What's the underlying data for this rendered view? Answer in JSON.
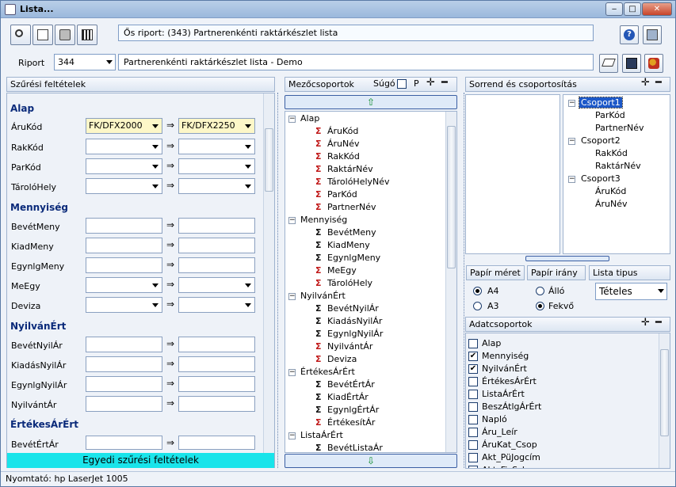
{
  "window": {
    "title": "Lista..."
  },
  "toolbar": {
    "report_header": "Ős riport: (343)  Partnerenkénti raktárkészlet lista"
  },
  "riport": {
    "label": "Riport",
    "code": "344",
    "name": "Partnerenkénti raktárkészlet lista - Demo"
  },
  "filters": {
    "title": "Szűrési feltételek",
    "arrow": "⇒",
    "sections": {
      "alap": "Alap",
      "mennyiseg": "Mennyiség",
      "nyilvanert": "NyilvánÉrt",
      "ertekesarert": "ÉrtékesÁrÉrt"
    },
    "rows": {
      "arukod": {
        "label": "ÁruKód",
        "from": "FK/DFX2000",
        "to": "FK/DFX2250"
      },
      "rakkod": {
        "label": "RakKód"
      },
      "parkod": {
        "label": "ParKód"
      },
      "tarolohely": {
        "label": "TárolóHely"
      },
      "betetmeny": {
        "label": "BevétMeny"
      },
      "kiadmeny": {
        "label": "KiadMeny"
      },
      "egynlgmeny": {
        "label": "EgynlgMeny"
      },
      "meegy": {
        "label": "MeEgy"
      },
      "deviza": {
        "label": "Deviza"
      },
      "betetnyilar": {
        "label": "BevétNyilÁr"
      },
      "kiadasnyilar": {
        "label": "KiadásNyilÁr"
      },
      "egynlgnyilar": {
        "label": "EgynlgNyilÁr"
      },
      "nyilvantar": {
        "label": "NyilvántÁr"
      },
      "betetertar": {
        "label": "BevétÉrtÁr"
      }
    },
    "custom_button": "Egyedi szűrési feltételek"
  },
  "fields": {
    "title": "Mezőcsoportok",
    "help": "Súgó",
    "p_label": "P",
    "tree": [
      {
        "type": "group",
        "label": "Alap"
      },
      {
        "type": "leaf",
        "sig": "red",
        "label": "ÁruKód"
      },
      {
        "type": "leaf",
        "sig": "red",
        "label": "ÁruNév"
      },
      {
        "type": "leaf",
        "sig": "red",
        "label": "RakKód"
      },
      {
        "type": "leaf",
        "sig": "red",
        "label": "RaktárNév"
      },
      {
        "type": "leaf",
        "sig": "red",
        "label": "TárolóHelyNév"
      },
      {
        "type": "leaf",
        "sig": "red",
        "label": "ParKód"
      },
      {
        "type": "leaf",
        "sig": "red",
        "label": "PartnerNév"
      },
      {
        "type": "group",
        "label": "Mennyiség"
      },
      {
        "type": "leaf",
        "sig": "blk",
        "label": "BevétMeny"
      },
      {
        "type": "leaf",
        "sig": "blk",
        "label": "KiadMeny"
      },
      {
        "type": "leaf",
        "sig": "blk",
        "label": "EgynlgMeny"
      },
      {
        "type": "leaf",
        "sig": "red",
        "label": "MeEgy"
      },
      {
        "type": "leaf",
        "sig": "red",
        "label": "TárolóHely"
      },
      {
        "type": "group",
        "label": "NyilvánÉrt"
      },
      {
        "type": "leaf",
        "sig": "blk",
        "label": "BevétNyilÁr"
      },
      {
        "type": "leaf",
        "sig": "blk",
        "label": "KiadásNyilÁr"
      },
      {
        "type": "leaf",
        "sig": "blk",
        "label": "EgynlgNyilÁr"
      },
      {
        "type": "leaf",
        "sig": "red",
        "label": "NyilvántÁr"
      },
      {
        "type": "leaf",
        "sig": "red",
        "label": "Deviza"
      },
      {
        "type": "group",
        "label": "ÉrtékesÁrÉrt"
      },
      {
        "type": "leaf",
        "sig": "blk",
        "label": "BevétÉrtÁr"
      },
      {
        "type": "leaf",
        "sig": "blk",
        "label": "KiadÉrtÁr"
      },
      {
        "type": "leaf",
        "sig": "blk",
        "label": "EgynlgÉrtÁr"
      },
      {
        "type": "leaf",
        "sig": "red",
        "label": "ÉrtékesítÁr"
      },
      {
        "type": "group",
        "label": "ListaÁrÉrt"
      },
      {
        "type": "leaf",
        "sig": "blk",
        "label": "BevétListaÁr"
      }
    ]
  },
  "sorting": {
    "title": "Sorrend és csoportosítás",
    "groups": [
      {
        "label": "Csoport1",
        "selected": true,
        "items": [
          "ParKód",
          "PartnerNév"
        ]
      },
      {
        "label": "Csoport2",
        "selected": false,
        "items": [
          "RakKód",
          "RaktárNév"
        ]
      },
      {
        "label": "Csoport3",
        "selected": false,
        "items": [
          "ÁruKód",
          "ÁruNév"
        ]
      }
    ]
  },
  "paper": {
    "size_title": "Papír méret",
    "orient_title": "Papír irány",
    "list_type_title": "Lista tipus",
    "a4": "A4",
    "a3": "A3",
    "allo": "Álló",
    "fekvo": "Fekvő",
    "list_type_value": "Tételes"
  },
  "datagroups": {
    "title": "Adatcsoportok",
    "items": [
      {
        "label": "Alap",
        "checked": false
      },
      {
        "label": "Mennyiség",
        "checked": true
      },
      {
        "label": "NyilvánÉrt",
        "checked": true
      },
      {
        "label": "ÉrtékesÁrÉrt",
        "checked": false
      },
      {
        "label": "ListaÁrÉrt",
        "checked": false
      },
      {
        "label": "BeszÁtlgÁrÉrt",
        "checked": false
      },
      {
        "label": "Napló",
        "checked": false
      },
      {
        "label": "Áru_Leír",
        "checked": false
      },
      {
        "label": "ÁruKat_Csop",
        "checked": false
      },
      {
        "label": "Akt_PüJogcím",
        "checked": false
      },
      {
        "label": "Akt_FizSzb",
        "checked": false
      }
    ]
  },
  "status": {
    "printer": "Nyomtató: hp LaserJet 1005"
  },
  "colors": {
    "accent_cyan": "#19e4ea",
    "section_blue": "#0a2a7a",
    "sigma_red": "#c01818"
  }
}
